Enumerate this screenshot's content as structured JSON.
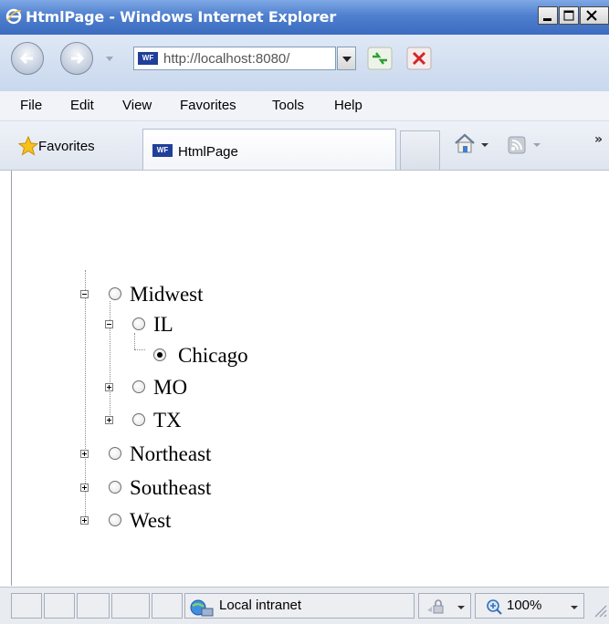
{
  "window": {
    "title": "HtmlPage - Windows Internet Explorer",
    "minimize_icon": "minimize-icon",
    "maximize_icon": "maximize-icon",
    "close_icon": "close-icon"
  },
  "toolbar": {
    "address_url": "http://localhost:8080/",
    "refresh_icon": "refresh-icon",
    "stop_icon": "stop-icon"
  },
  "menu": {
    "items": [
      "File",
      "Edit",
      "View",
      "Favorites",
      "Tools",
      "Help"
    ]
  },
  "favorites_bar": {
    "favorites_label": "Favorites",
    "tab_label": "HtmlPage",
    "more_label": "»"
  },
  "tree": {
    "nodes": [
      {
        "label": "Midwest",
        "expanded": true,
        "selected": false
      },
      {
        "label": "IL",
        "expanded": true,
        "selected": false
      },
      {
        "label": "Chicago",
        "leaf": true,
        "selected": true
      },
      {
        "label": "MO",
        "expanded": false,
        "selected": false
      },
      {
        "label": "TX",
        "expanded": false,
        "selected": false
      },
      {
        "label": "Northeast",
        "expanded": false,
        "selected": false
      },
      {
        "label": "Southeast",
        "expanded": false,
        "selected": false
      },
      {
        "label": "West",
        "expanded": false,
        "selected": false
      }
    ]
  },
  "status_bar": {
    "zone": "Local intranet",
    "zoom": "100%"
  }
}
